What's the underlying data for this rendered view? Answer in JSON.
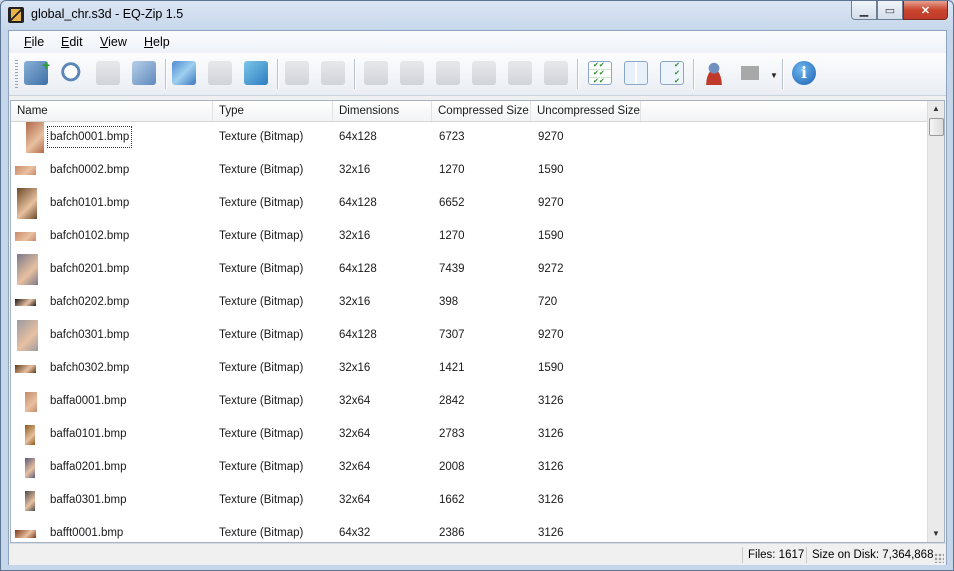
{
  "window": {
    "title": "global_chr.s3d - EQ-Zip 1.5"
  },
  "menu": [
    {
      "label": "File",
      "mnemonic": "F",
      "rest": "ile"
    },
    {
      "label": "Edit",
      "mnemonic": "E",
      "rest": "dit"
    },
    {
      "label": "View",
      "mnemonic": "V",
      "rest": "iew"
    },
    {
      "label": "Help",
      "mnemonic": "H",
      "rest": "elp"
    }
  ],
  "columns": [
    "Name",
    "Type",
    "Dimensions",
    "Compressed Size",
    "Uncompressed Size"
  ],
  "rows": [
    {
      "name": "bafch0001.bmp",
      "type": "Texture (Bitmap)",
      "dimensions": "64x128",
      "compressed": "6723",
      "uncompressed": "9270"
    },
    {
      "name": "bafch0002.bmp",
      "type": "Texture (Bitmap)",
      "dimensions": "32x16",
      "compressed": "1270",
      "uncompressed": "1590"
    },
    {
      "name": "bafch0101.bmp",
      "type": "Texture (Bitmap)",
      "dimensions": "64x128",
      "compressed": "6652",
      "uncompressed": "9270"
    },
    {
      "name": "bafch0102.bmp",
      "type": "Texture (Bitmap)",
      "dimensions": "32x16",
      "compressed": "1270",
      "uncompressed": "1590"
    },
    {
      "name": "bafch0201.bmp",
      "type": "Texture (Bitmap)",
      "dimensions": "64x128",
      "compressed": "7439",
      "uncompressed": "9272"
    },
    {
      "name": "bafch0202.bmp",
      "type": "Texture (Bitmap)",
      "dimensions": "32x16",
      "compressed": "398",
      "uncompressed": "720"
    },
    {
      "name": "bafch0301.bmp",
      "type": "Texture (Bitmap)",
      "dimensions": "64x128",
      "compressed": "7307",
      "uncompressed": "9270"
    },
    {
      "name": "bafch0302.bmp",
      "type": "Texture (Bitmap)",
      "dimensions": "32x16",
      "compressed": "1421",
      "uncompressed": "1590"
    },
    {
      "name": "baffa0001.bmp",
      "type": "Texture (Bitmap)",
      "dimensions": "32x64",
      "compressed": "2842",
      "uncompressed": "3126"
    },
    {
      "name": "baffa0101.bmp",
      "type": "Texture (Bitmap)",
      "dimensions": "32x64",
      "compressed": "2783",
      "uncompressed": "3126"
    },
    {
      "name": "baffa0201.bmp",
      "type": "Texture (Bitmap)",
      "dimensions": "32x64",
      "compressed": "2008",
      "uncompressed": "3126"
    },
    {
      "name": "baffa0301.bmp",
      "type": "Texture (Bitmap)",
      "dimensions": "32x64",
      "compressed": "1662",
      "uncompressed": "3126"
    },
    {
      "name": "bafft0001.bmp",
      "type": "Texture (Bitmap)",
      "dimensions": "64x32",
      "compressed": "2386",
      "uncompressed": "3126"
    }
  ],
  "thumbnail_colors": [
    "#b06a4a",
    "#c98a6a",
    "#6a4a2a",
    "#c88a6c",
    "#7a7a8a",
    "#1a1a1a",
    "#9a9aa0",
    "#5a3a1a",
    "#c48a6a",
    "#8a5a1a",
    "#5a5a7a",
    "#4a4a4a",
    "#7a3a1a"
  ],
  "status": {
    "files": "Files: 1617",
    "size_on_disk": "Size on Disk: 7,364,868"
  },
  "toolbar_icons": [
    "open-archive-icon",
    "find-icon",
    "add-files-icon",
    "extract-icon",
    "view-image-icon",
    "replace-image-icon",
    "export-image-icon",
    "move-up-icon",
    "move-down-icon",
    "cut-icon",
    "copy-icon",
    "paste-icon",
    "delete-icon",
    "rename-icon",
    "properties-icon",
    "select-all-icon",
    "select-none-icon",
    "invert-selection-icon",
    "user-icon",
    "image-view-icon",
    "info-icon"
  ]
}
